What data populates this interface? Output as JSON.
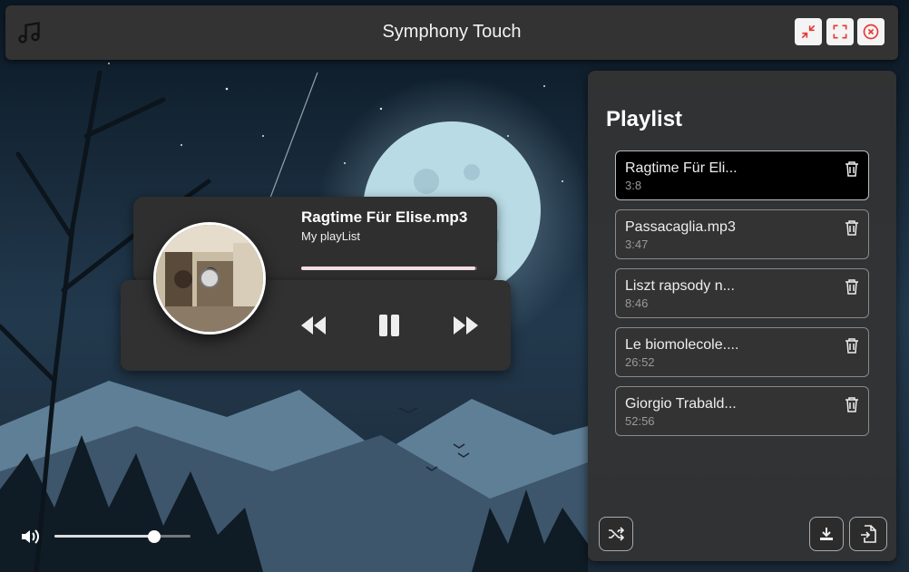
{
  "app": {
    "title": "Symphony Touch"
  },
  "now_playing": {
    "title": "Ragtime Für Elise.mp3",
    "playlist_name": "My playList",
    "progress": 0.99
  },
  "volume": {
    "level": 0.73
  },
  "playlist": {
    "heading": "Playlist",
    "items": [
      {
        "name": "Ragtime Für Eli...",
        "duration": "3:8",
        "active": true
      },
      {
        "name": "Passacaglia.mp3",
        "duration": "3:47",
        "active": false
      },
      {
        "name": "Liszt rapsody n...",
        "duration": "8:46",
        "active": false
      },
      {
        "name": "Le biomolecole....",
        "duration": "26:52",
        "active": false
      },
      {
        "name": "Giorgio Trabald...",
        "duration": "52:56",
        "active": false
      }
    ]
  },
  "colors": {
    "window_button_icon": "#e53935",
    "panel": "#333333",
    "accent_progress": "#f3dde3"
  },
  "icons": {
    "app": "music-note-icon",
    "minimize": "compress-icon",
    "fullscreen": "fullscreen-icon",
    "close": "close-circle-icon",
    "rewind": "rewind-icon",
    "pause": "pause-icon",
    "forward": "fast-forward-icon",
    "volume": "volume-icon",
    "shuffle": "shuffle-icon",
    "download": "download-icon",
    "import": "file-import-icon",
    "delete": "trash-icon"
  }
}
